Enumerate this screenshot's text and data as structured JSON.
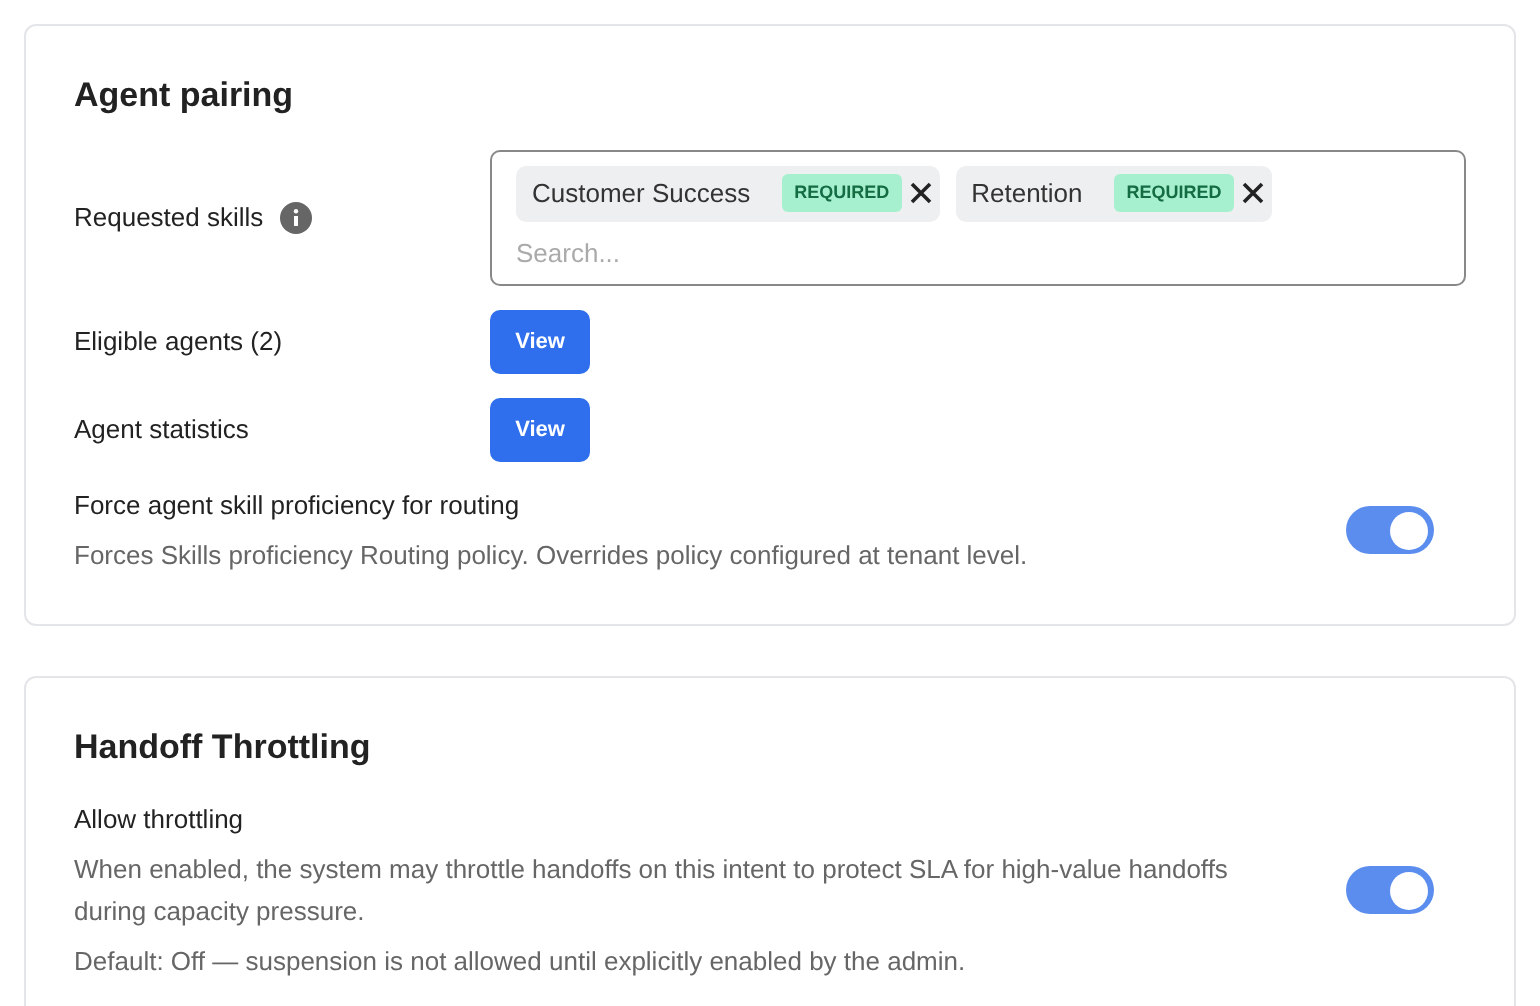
{
  "sections": [
    {
      "title": "Agent pairing",
      "rows": [
        {
          "kind": "skills",
          "label": "Requested skills",
          "skills": [
            {
              "name": "Customer Success",
              "badge": "REQUIRED"
            },
            {
              "name": "Retention",
              "badge": "REQUIRED"
            }
          ],
          "placeholder": "Search..."
        },
        {
          "kind": "button",
          "label": "Eligible agents (2)",
          "button": "View"
        },
        {
          "kind": "button",
          "label": "Agent statistics",
          "button": "View"
        },
        {
          "kind": "toggle",
          "label": "Force agent skill proficiency for routing",
          "descriptions": [
            "Forces Skills proficiency Routing policy. Overrides policy configured at tenant level."
          ],
          "on": true
        }
      ]
    },
    {
      "title": "Handoff Throttling",
      "rows": [
        {
          "kind": "toggle",
          "label": "Allow throttling",
          "descriptions": [
            "When enabled, the system may throttle handoffs on this intent to protect SLA for high-value handoffs during capacity pressure.",
            "Default: Off — suspension is not allowed until explicitly enabled by the admin."
          ],
          "on": true
        }
      ]
    }
  ]
}
